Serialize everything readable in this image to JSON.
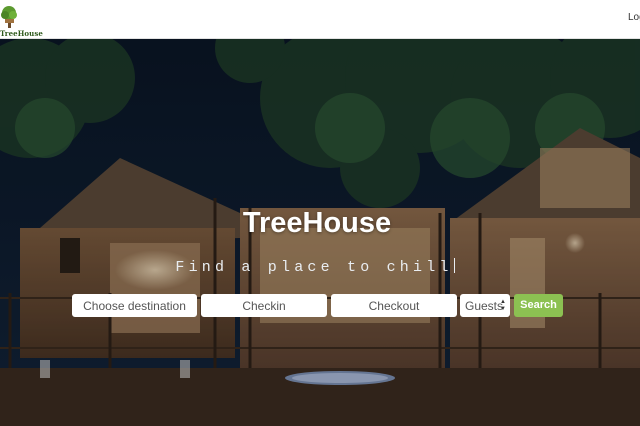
{
  "navbar": {
    "logo_text": "TreeHouse",
    "login_label": "Log"
  },
  "hero": {
    "title": "TreeHouse",
    "tagline": "Find a place to chill"
  },
  "search": {
    "destination_placeholder": "Choose destination",
    "checkin_placeholder": "Checkin",
    "checkout_placeholder": "Checkout",
    "guests_label": "Guests",
    "search_label": "Search"
  },
  "colors": {
    "search_button": "#8cc152",
    "navbar": "#ffffff"
  },
  "icons": {
    "logo": "tree-logo-icon",
    "guests_selector": "up-down-arrow-icon"
  }
}
